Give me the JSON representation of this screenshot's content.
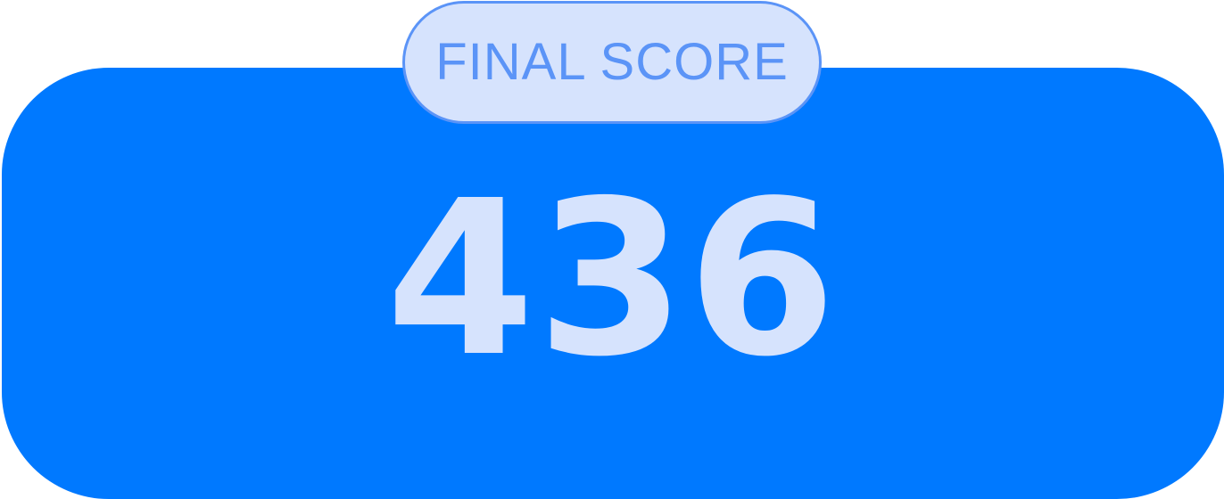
{
  "score_panel": {
    "label": "FINAL SCORE",
    "score": "436"
  },
  "colors": {
    "panel_background": "#0079ff",
    "text_light": "#d6e3fd",
    "label_accent": "#5b94f7"
  }
}
